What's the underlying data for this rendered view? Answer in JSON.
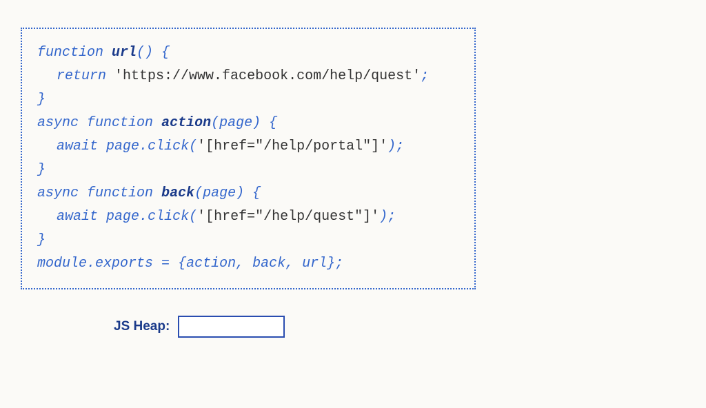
{
  "code": {
    "line1_kw1": "function",
    "line1_fn": "url",
    "line1_rest": "() {",
    "line2_kw": "return",
    "line2_str": "'https://www.facebook.com/help/quest'",
    "line2_semi": ";",
    "line3": "}",
    "line4_kw1": "async",
    "line4_kw2": "function",
    "line4_fn": "action",
    "line4_rest": "(page) {",
    "line5_kw": "await",
    "line5_obj": "page",
    "line5_dot": ".",
    "line5_method": "click",
    "line5_open": "(",
    "line5_str": "'[href=\"/help/portal\"]'",
    "line5_close": ");",
    "line6": "}",
    "line7_kw1": "async",
    "line7_kw2": "function",
    "line7_fn": "back",
    "line7_rest": "(page) {",
    "line8_kw": "await",
    "line8_obj": "page",
    "line8_dot": ".",
    "line8_method": "click",
    "line8_open": "(",
    "line8_str": "'[href=\"/help/quest\"]'",
    "line8_close": ");",
    "line9": "}",
    "line10_a": "module",
    "line10_dot": ".",
    "line10_b": "exports",
    "line10_eq": " = ",
    "line10_c": "{action, back, url};"
  },
  "heap": {
    "label": "JS Heap:",
    "value": ""
  }
}
